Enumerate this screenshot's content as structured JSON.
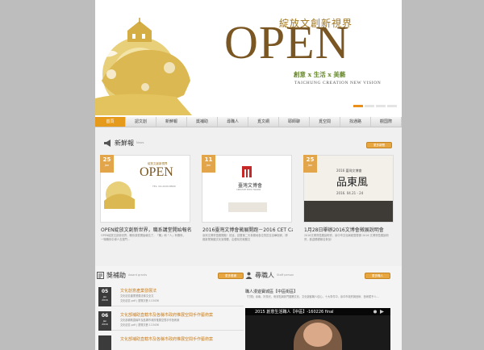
{
  "banner": {
    "title_cn": "綻放文創新視界",
    "logo": "OPEN",
    "tagline": "創意 x 生活 x 美藝",
    "subtitle_en": "TAICHUNG CREATION NEW VISION"
  },
  "nav": {
    "items": [
      "首頁",
      "認文創",
      "新鮮報",
      "獎補助",
      "尋職人",
      "覓文網",
      "耶師聊",
      "覓空間",
      "找通路",
      "觀国際"
    ]
  },
  "news": {
    "title": "新鮮報",
    "subtitle": "News",
    "more": "更多新聞",
    "cards": [
      {
        "day": "25",
        "month": "Jan",
        "title": "OPEN綻放文創新世界，職系講堂開始報名",
        "desc": "OPEN綻放文創新世界，職系講堂開始報名了，「職」和「人」有關係，一場職系引導人去選門…",
        "logo_cn": "綻放文創新視界",
        "logo": "OPEN",
        "phone": "TEL: 04-2220-8899"
      },
      {
        "day": "11",
        "month": "Jan",
        "title": "2016臺灣文博會徵展開跑－2016 CET Call",
        "desc": "臺灣文博會徵展開跑！初這，搶攤第二天參展地各位的區至自華個家，博觀新業第國文化宣傳要，由優化的競勝文",
        "poster_title": "臺灣文博會",
        "poster_sub": "CREATIVE EXPO TAIWAN"
      },
      {
        "day": "25",
        "month": "Jan",
        "title": "1月28日舉辦2016文博會徵展說明會",
        "desc": "2016文博會徵展說明會，臺中市文化局統籌籌辦 2016 文博會徵展說明會，歡迎踴躍報名參加!",
        "poster_top": "2016 臺灣文博會",
        "poster_title": "品東風",
        "poster_date": "2016. 04.21 - 24"
      }
    ]
  },
  "grants": {
    "title": "獎補助",
    "subtitle": "Award grants",
    "more": "更多獎補",
    "rows": [
      {
        "day": "05",
        "month": "Jan",
        "year": "2016",
        "title": "文化創意產業發展法",
        "desc": "文化創意產業發展法條文全文",
        "file": "文化創意.pdf | 瀏覽次數 113436"
      },
      {
        "day": "06",
        "month": "Jan",
        "year": "2016",
        "title": "文化部補助直轄市及各縣市政府推展空間手作藝術案",
        "desc": "文化部補助直轄市及各縣市政府推展空間手作藝術案",
        "file": "文化創意.pdf | 瀏覽次數 113436"
      },
      {
        "day": "",
        "month": "",
        "year": "",
        "title": "文化部補助直轄市及各縣市政府推展空間手作藝術案",
        "desc": "",
        "file": ""
      }
    ]
  },
  "jobs": {
    "title": "尋職人",
    "subtitle": "Staff person",
    "more": "更多職人",
    "headline": "職人漫遊寶城區【中區街區】",
    "desc": "「打開」臺南，好風光，而景點與熱門圖騰文化，文化遊客職人信心，十大事件中，臺中市政府與藝術、藝術賦予人…",
    "video_title": "2015 創意生活職人【中區】-160226 final"
  },
  "colors": {
    "accent": "#e69a1c",
    "gold": "#7a5623",
    "green": "#6a8b2e"
  }
}
